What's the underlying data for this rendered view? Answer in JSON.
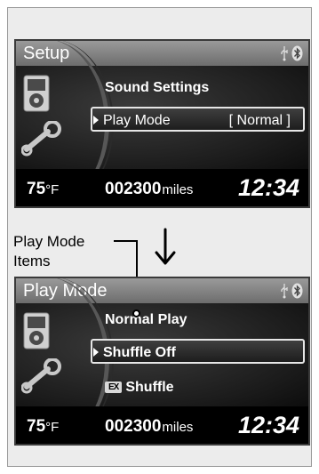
{
  "setup_screen": {
    "title": "Setup",
    "items": [
      {
        "label": "Sound Settings"
      },
      {
        "label": "Play Mode",
        "value": "[  Normal  ]"
      }
    ]
  },
  "play_mode_screen": {
    "title": "Play Mode",
    "items": [
      {
        "label": "Normal Play"
      },
      {
        "label": "Shuffle Off"
      },
      {
        "badge": "EX",
        "label": "Shuffle"
      }
    ]
  },
  "footer": {
    "temperature": "75",
    "temperature_unit": "°F",
    "odometer": "002300",
    "odometer_unit": "miles",
    "clock": "12:34"
  },
  "callout": {
    "line1": "Play Mode",
    "line2": "Items"
  },
  "icons": [
    "usb-icon",
    "bluetooth-icon",
    "ipod-icon",
    "wrench-icon",
    "down-arrow-icon"
  ]
}
